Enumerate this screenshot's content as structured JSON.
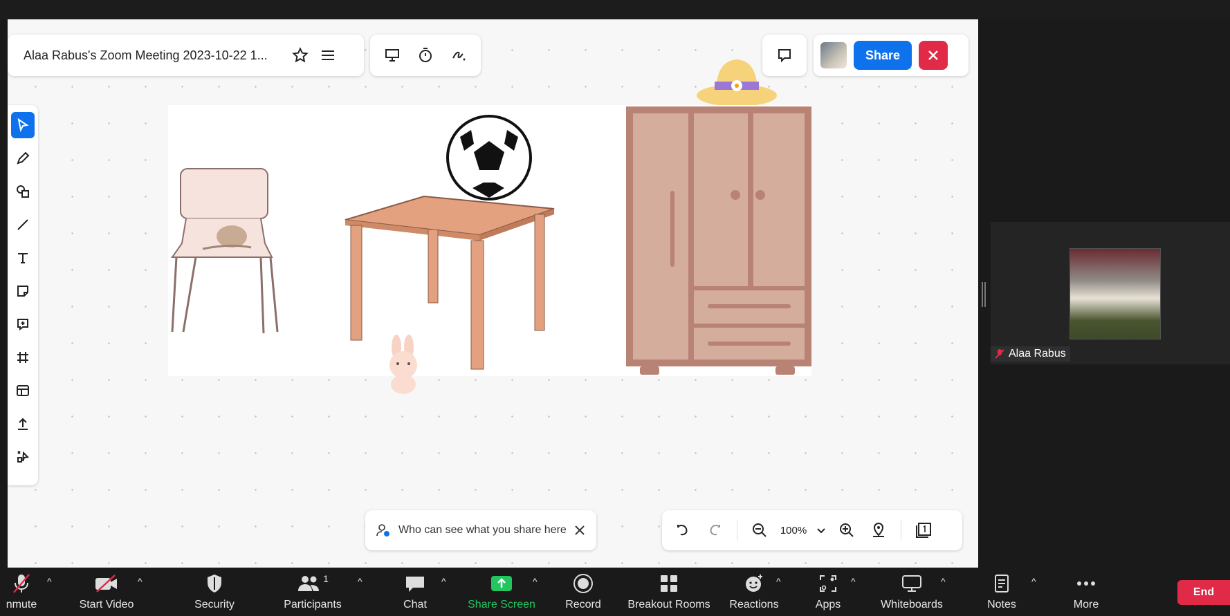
{
  "meeting": {
    "title": "Alaa Rabus's Zoom Meeting 2023-10-22 1..."
  },
  "header": {
    "share_label": "Share"
  },
  "share_notice": {
    "text": "Who can see what you share here"
  },
  "zoom": {
    "level": "100%"
  },
  "participant": {
    "name": "Alaa Rabus"
  },
  "toolbar": {
    "unmute": "nmute",
    "start_video": "Start Video",
    "security": "Security",
    "participants": "Participants",
    "participants_count": "1",
    "chat": "Chat",
    "share_screen": "Share Screen",
    "record": "Record",
    "breakout_rooms": "Breakout Rooms",
    "reactions": "Reactions",
    "apps": "Apps",
    "whiteboards": "Whiteboards",
    "notes": "Notes",
    "more": "More",
    "end": "End"
  },
  "colors": {
    "accent": "#0e72ed",
    "danger": "#e02a47",
    "share_green": "#22c55e"
  }
}
